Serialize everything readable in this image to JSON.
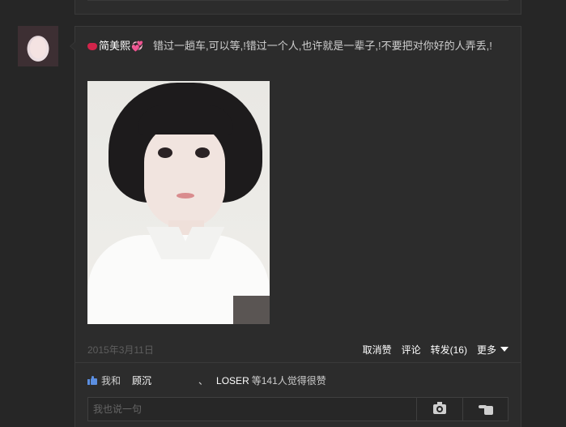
{
  "post": {
    "author": "简美熙",
    "text": "错过一趟车,可以等,!错过一个人,也许就是一辈子,!不要把对你好的人弄丢,!",
    "date": "2015年3月11日"
  },
  "actions": {
    "unlike": "取消赞",
    "comment": "评论",
    "forward": "转发(16)",
    "more": "更多"
  },
  "likes": {
    "me_and": "我和",
    "liker1": "顾沉",
    "separator": "、",
    "liker2": "LOSER",
    "summary": "等141人觉得很赞"
  },
  "comment": {
    "placeholder": "我也说一句"
  },
  "icons": {
    "author_prefix": "lips-icon",
    "author_suffix": "heart-icon",
    "like": "thumbs-up-icon",
    "more": "caret-down-icon",
    "photo_button": "camera-icon",
    "poke_button": "pointing-hand-icon"
  },
  "colors": {
    "background": "#262626",
    "card": "#2c2c2c",
    "border": "#3a3a3a",
    "text": "#cfcfcf",
    "date": "#5e5e5e",
    "link": "#ffffff",
    "like_blue": "#5b8ee0"
  }
}
